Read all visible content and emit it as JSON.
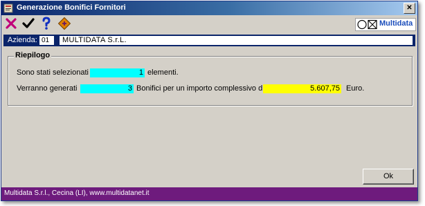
{
  "window": {
    "title": "Generazione Bonifici Fornitori",
    "close_glyph": "✕"
  },
  "toolbar": {
    "buttons": [
      {
        "icon": "close-x-icon",
        "color": "#c0007a"
      },
      {
        "icon": "checkmark-icon",
        "color": "#000000"
      },
      {
        "icon": "help-question-icon",
        "color": "#1030c0"
      },
      {
        "icon": "tools-icon",
        "color": "#e08000"
      }
    ],
    "brand": "Multidata"
  },
  "azienda": {
    "label": "Azienda:",
    "code": "01",
    "name": "MULTIDATA S.r.L."
  },
  "riepilogo": {
    "title": "Riepilogo",
    "row1": {
      "prefix": "Sono stati selezionati",
      "value": "1",
      "suffix": "elementi."
    },
    "row2": {
      "prefix": "Verranno generati",
      "value": "3",
      "middle": "Bonifici  per un importo complessivo di",
      "amount": "5.607,75",
      "suffix": "Euro."
    }
  },
  "actions": {
    "ok_label": "Ok"
  },
  "status": {
    "text": "Multidata S.r.l., Cecina (LI), www.multidatanet.it"
  },
  "colors": {
    "accent": "#0a246a",
    "status_bar": "#6e1b7d",
    "field_cyan": "#00ffff",
    "field_yellow": "#ffff00"
  }
}
